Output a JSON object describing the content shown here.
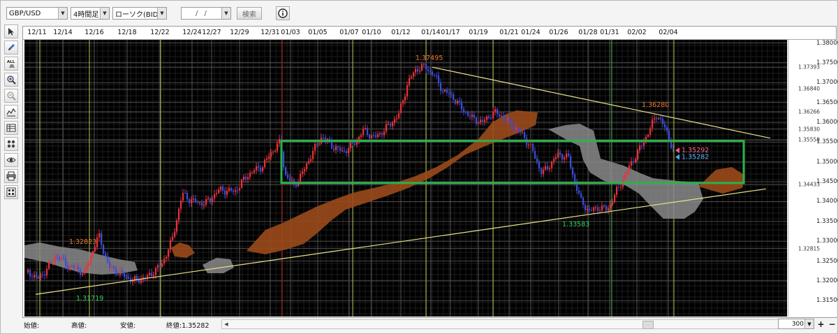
{
  "toolbar": {
    "symbol": "GBP/USD",
    "timeframe": "4時間足",
    "chart_kind": "ローソク(BID)",
    "date_value": "/ /",
    "search_label": "検索"
  },
  "left_tools": [
    "cursor-icon",
    "pencil-icon",
    "all-clear-icon",
    "zoom-in-icon",
    "zoom-out-icon",
    "indicator-icon",
    "table-icon",
    "dots-icon",
    "eye-icon",
    "print-icon",
    "settings-grid-icon"
  ],
  "status": {
    "open_label": "始値:",
    "high_label": "高値:",
    "low_label": "安値:",
    "close_label": "終値:1.35282",
    "zoom_value": "300",
    "plus": "+",
    "minus": "−"
  },
  "colors": {
    "background": "#000000",
    "bullish": "#e8323a",
    "bearish": "#3c4cd8",
    "cloud_orange": "#9a4a1a",
    "cloud_gray": "#8a8a8a",
    "trendline": "#e8e28a",
    "box": "#29b14a",
    "high_label": "#e8772e",
    "low_label": "#33cc55"
  },
  "chart_data": {
    "type": "candlestick",
    "x_ticks": [
      "12/11",
      "12/14",
      "12/16",
      "12/18",
      "12/22",
      "12/24",
      "12/27",
      "12/29",
      "12/31",
      "01/03",
      "01/05",
      "01/07",
      "01/10",
      "01/12",
      "01/14",
      "01/17",
      "01/19",
      "01/21",
      "01/24",
      "01/26",
      "01/28",
      "01/31",
      "02/02",
      "02/04"
    ],
    "y_ticks": [
      "1.38000",
      "1.37500",
      "1.37000",
      "1.36500",
      "1.36000",
      "1.35500",
      "1.35000",
      "1.34500",
      "1.34000",
      "1.33500",
      "1.33000",
      "1.32500",
      "1.32000",
      "1.31500"
    ],
    "ylim": [
      1.311,
      1.3808
    ],
    "minor_price_labels": [
      {
        "value": 1.37393,
        "text": "1.37393"
      },
      {
        "value": 1.3684,
        "text": "1.36840"
      },
      {
        "value": 1.36266,
        "text": "1.36266"
      },
      {
        "value": 1.3583,
        "text": "1.35830"
      },
      {
        "value": 1.35558,
        "text": "1.35558"
      },
      {
        "value": 1.34433,
        "text": "1.34433"
      },
      {
        "value": 1.32815,
        "text": "1.32815"
      }
    ],
    "current_bid": "1.35292",
    "current_close": "1.35282",
    "annotations": [
      {
        "text": "1.37495",
        "kind": "high",
        "price": 1.37495
      },
      {
        "text": "1.36280",
        "kind": "high",
        "price": 1.3628
      },
      {
        "text": "1.32823",
        "kind": "high",
        "price": 1.32823
      },
      {
        "text": "1.33583",
        "kind": "low",
        "price": 1.33583
      },
      {
        "text": "1.31719",
        "kind": "low",
        "price": 1.31719
      }
    ],
    "highlight_box": {
      "price_top": 1.3553,
      "price_bottom": 1.3447
    }
  }
}
